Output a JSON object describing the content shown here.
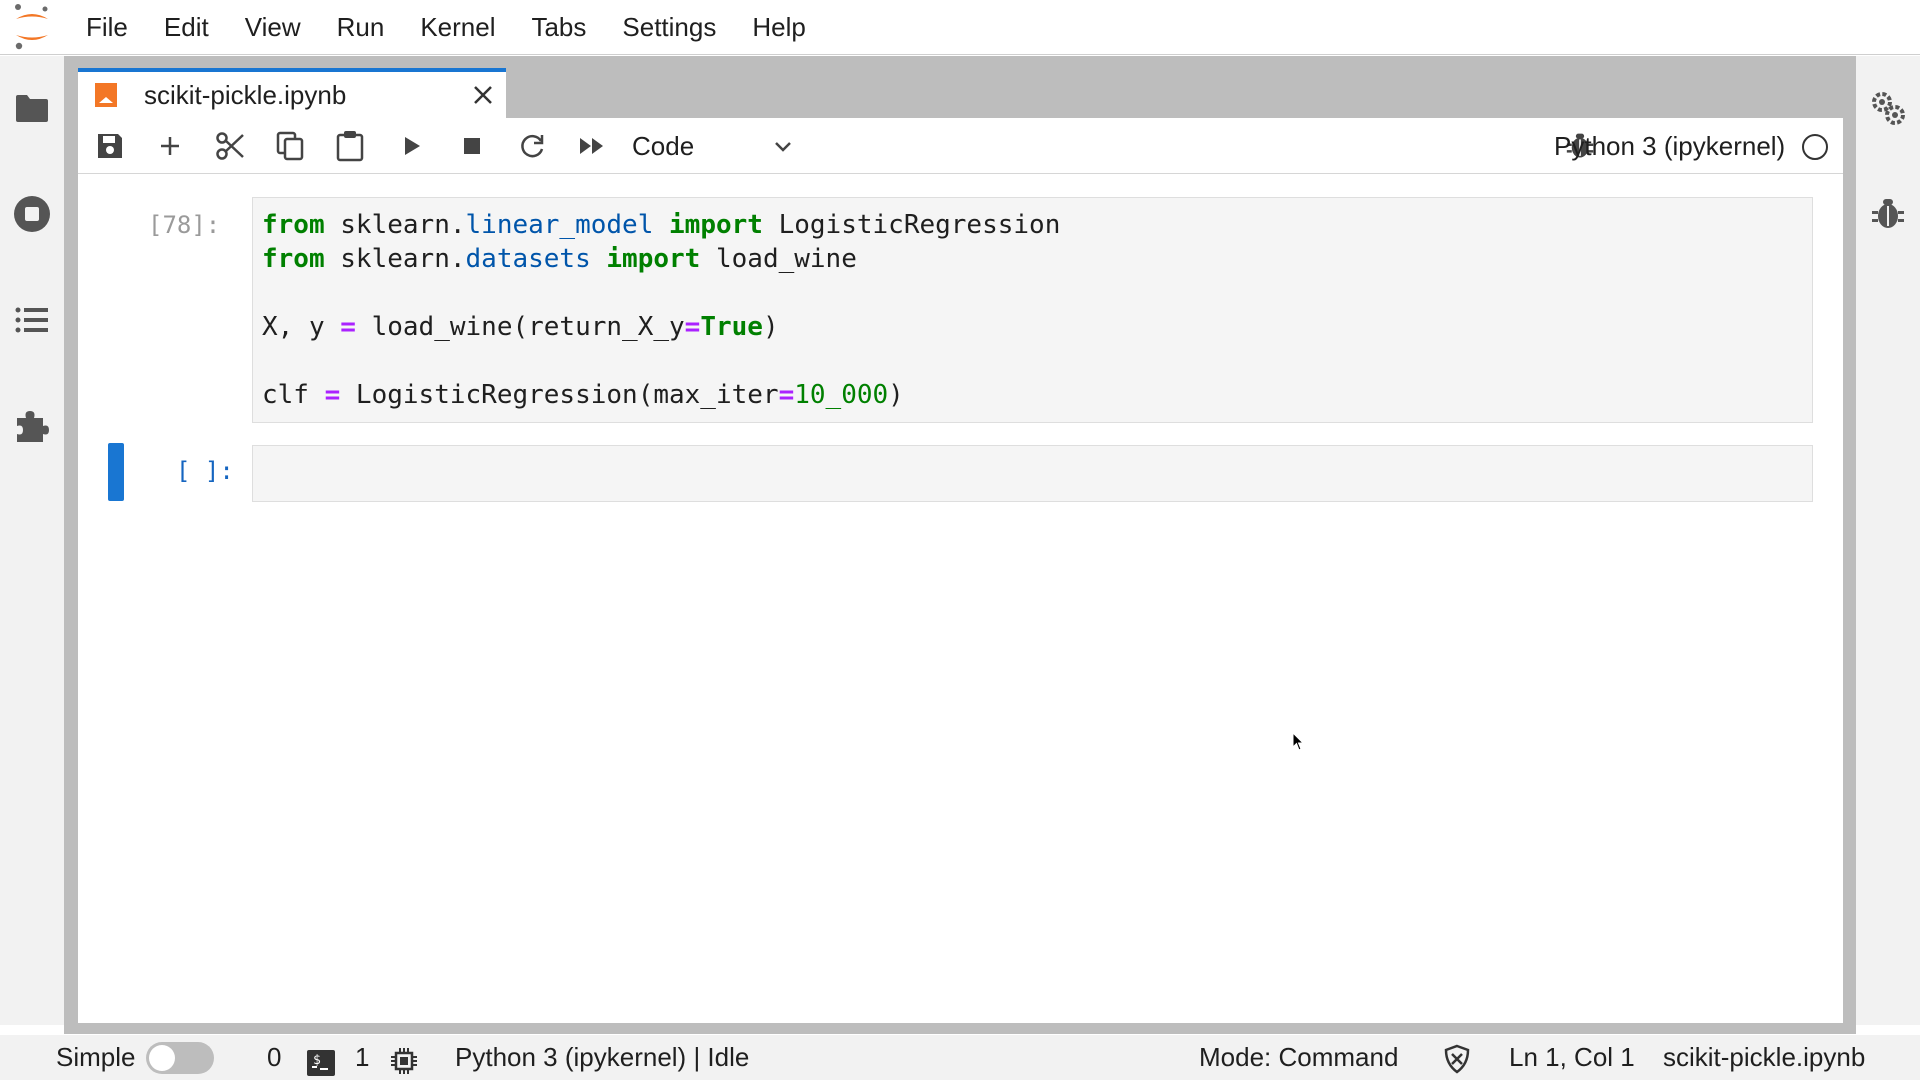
{
  "menubar": {
    "logo": "jupyter-logo",
    "items": [
      "File",
      "Edit",
      "View",
      "Run",
      "Kernel",
      "Tabs",
      "Settings",
      "Help"
    ]
  },
  "left_sidebar": {
    "icons": [
      "folder-icon",
      "stop-circle-icon",
      "list-icon",
      "puzzle-icon"
    ]
  },
  "right_sidebar": {
    "icons": [
      "gears-icon",
      "bug-icon"
    ]
  },
  "tab": {
    "title": "scikit-pickle.ipynb",
    "icon": "notebook-icon",
    "close_icon": "close-icon",
    "accent_color": "#1976d2"
  },
  "toolbar": {
    "buttons": [
      "save-icon",
      "add-icon",
      "cut-icon",
      "copy-icon",
      "paste-icon",
      "run-icon",
      "stop-icon",
      "restart-icon",
      "fast-forward-icon"
    ],
    "cell_type": "Code",
    "kernel_name": "Python 3 (ipykernel)",
    "kernel_status_icon": "circle-idle-icon"
  },
  "cells": [
    {
      "prompt": "[78]:",
      "lines": [
        "from sklearn.linear_model import LogisticRegression",
        "from sklearn.datasets import load_wine",
        "",
        "X, y = load_wine(return_X_y=True)",
        "",
        "clf = LogisticRegression(max_iter=10_000)"
      ]
    },
    {
      "prompt": "[ ]:",
      "lines": [
        ""
      ],
      "active": true
    }
  ],
  "statusbar": {
    "mode_label": "Simple",
    "simple_toggle_on": false,
    "terminals_count": "0",
    "kernels_count": "1",
    "kernel_status": "Python 3 (ipykernel) | Idle",
    "mode": "Mode: Command",
    "cursor_position": "Ln 1, Col 1",
    "filename": "scikit-pickle.ipynb"
  },
  "colors": {
    "accent": "#1976d2",
    "keyword": "#008000",
    "operator": "#aa22ff",
    "module": "#0055aa",
    "logo_orange": "#f37726"
  }
}
